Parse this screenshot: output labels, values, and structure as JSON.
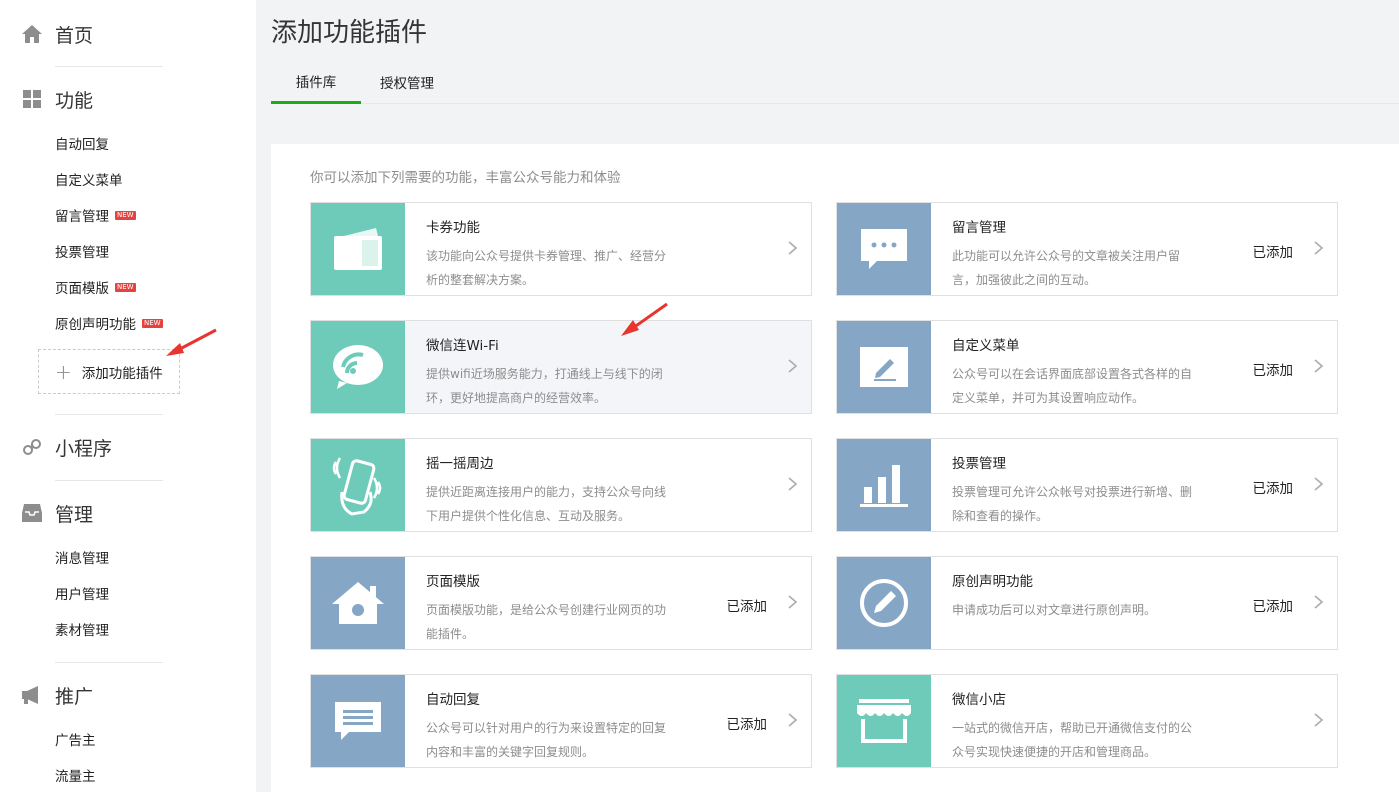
{
  "sidebar": {
    "home": "首页",
    "features": {
      "title": "功能",
      "items": [
        "自动回复",
        "自定义菜单",
        "留言管理",
        "投票管理",
        "页面模版",
        "原创声明功能"
      ],
      "new_badge": "NEW",
      "add_plugin": "添加功能插件"
    },
    "mini_program": "小程序",
    "manage": {
      "title": "管理",
      "items": [
        "消息管理",
        "用户管理",
        "素材管理"
      ]
    },
    "promote": {
      "title": "推广",
      "items": [
        "广告主",
        "流量主"
      ]
    }
  },
  "page": {
    "title": "添加功能插件",
    "tabs": [
      "插件库",
      "授权管理"
    ],
    "hint": "你可以添加下列需要的功能，丰富公众号能力和体验"
  },
  "plugins": [
    {
      "name": "卡券功能",
      "desc": "该功能向公众号提供卡券管理、推广、经营分析的整套解决方案。",
      "status": "",
      "icon": "card-icon",
      "color": "#6fcbb9"
    },
    {
      "name": "留言管理",
      "desc": "此功能可以允许公众号的文章被关注用户留言，加强彼此之间的互动。",
      "status": "已添加",
      "icon": "comment-icon",
      "color": "#86a6c6"
    },
    {
      "name": "微信连Wi-Fi",
      "desc": "提供wifi近场服务能力，打通线上与线下的闭环，更好地提高商户的经营效率。",
      "status": "",
      "icon": "wifi-icon",
      "color": "#6fcbb9"
    },
    {
      "name": "自定义菜单",
      "desc": "公众号可以在会话界面底部设置各式各样的自定义菜单，并可为其设置响应动作。",
      "status": "已添加",
      "icon": "edit-icon",
      "color": "#86a6c6"
    },
    {
      "name": "摇一摇周边",
      "desc": "提供近距离连接用户的能力，支持公众号向线下用户提供个性化信息、互动及服务。",
      "status": "",
      "icon": "shake-icon",
      "color": "#6fcbb9"
    },
    {
      "name": "投票管理",
      "desc": "投票管理可允许公众帐号对投票进行新增、删除和查看的操作。",
      "status": "已添加",
      "icon": "bar-chart-icon",
      "color": "#86a6c6"
    },
    {
      "name": "页面模版",
      "desc": "页面模版功能，是给公众号创建行业网页的功能插件。",
      "status": "已添加",
      "icon": "home-icon",
      "color": "#86a6c6"
    },
    {
      "name": "原创声明功能",
      "desc": "申请成功后可以对文章进行原创声明。",
      "status": "已添加",
      "icon": "pen-circle-icon",
      "color": "#86a6c6"
    },
    {
      "name": "自动回复",
      "desc": "公众号可以针对用户的行为来设置特定的回复内容和丰富的关键字回复规则。",
      "status": "已添加",
      "icon": "message-icon",
      "color": "#86a6c6"
    },
    {
      "name": "微信小店",
      "desc": "一站式的微信开店，帮助已开通微信支付的公众号实现快速便捷的开店和管理商品。",
      "status": "",
      "icon": "shop-icon",
      "color": "#6fcbb9"
    }
  ]
}
